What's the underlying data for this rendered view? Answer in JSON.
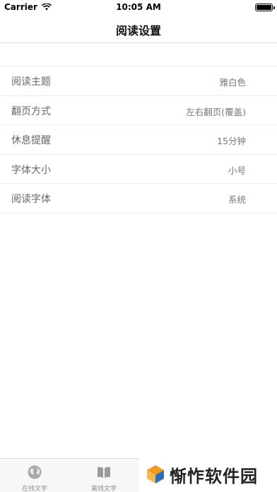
{
  "status_bar": {
    "carrier": "Carrier",
    "time": "10:05 AM",
    "battery_level": 1.0
  },
  "nav": {
    "title": "阅读设置"
  },
  "settings": [
    {
      "label": "阅读主题",
      "value": "雅白色"
    },
    {
      "label": "翻页方式",
      "value": "左右翻页(覆盖)"
    },
    {
      "label": "休息提醒",
      "value": "15分钟"
    },
    {
      "label": "字体大小",
      "value": "小号"
    },
    {
      "label": "阅读字体",
      "value": "系统"
    }
  ],
  "tabs": [
    {
      "label": "在线文学",
      "icon": "globe-icon"
    },
    {
      "label": "离线文学",
      "icon": "book-icon"
    }
  ],
  "watermark": {
    "text": "惭怍软件园"
  },
  "colors": {
    "logo_orange": "#f39a1f",
    "logo_blue": "#2a6fb8",
    "tab_icon": "#9a9a9a"
  }
}
